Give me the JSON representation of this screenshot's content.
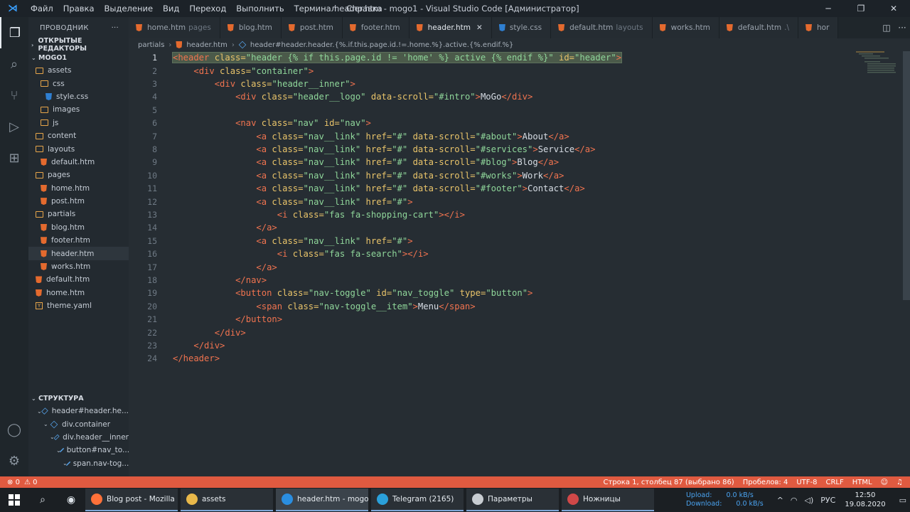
{
  "titlebar": {
    "menu": [
      "Файл",
      "Правка",
      "Выделение",
      "Вид",
      "Переход",
      "Выполнить",
      "Терминал",
      "Справка"
    ],
    "title": "header.htm - mogo1 - Visual Studio Code [Администратор]"
  },
  "sidebar": {
    "header": "ПРОВОДНИК",
    "open_editors": "ОТКРЫТЫЕ РЕДАКТОРЫ",
    "project": "MOGO1",
    "tree": [
      {
        "label": "assets",
        "type": "folder",
        "depth": 0
      },
      {
        "label": "css",
        "type": "folder",
        "depth": 1
      },
      {
        "label": "style.css",
        "type": "css",
        "depth": 2
      },
      {
        "label": "images",
        "type": "folder",
        "depth": 1
      },
      {
        "label": "js",
        "type": "folder",
        "depth": 1
      },
      {
        "label": "content",
        "type": "folder",
        "depth": 0
      },
      {
        "label": "layouts",
        "type": "folder",
        "depth": 0
      },
      {
        "label": "default.htm",
        "type": "html",
        "depth": 1
      },
      {
        "label": "pages",
        "type": "folder",
        "depth": 0
      },
      {
        "label": "home.htm",
        "type": "html",
        "depth": 1
      },
      {
        "label": "post.htm",
        "type": "html",
        "depth": 1
      },
      {
        "label": "partials",
        "type": "folder",
        "depth": 0
      },
      {
        "label": "blog.htm",
        "type": "html",
        "depth": 1
      },
      {
        "label": "footer.htm",
        "type": "html",
        "depth": 1
      },
      {
        "label": "header.htm",
        "type": "html",
        "depth": 1,
        "selected": true
      },
      {
        "label": "works.htm",
        "type": "html",
        "depth": 1
      },
      {
        "label": "default.htm",
        "type": "html",
        "depth": 0
      },
      {
        "label": "home.htm",
        "type": "html",
        "depth": 0
      },
      {
        "label": "theme.yaml",
        "type": "yaml",
        "depth": 0
      }
    ],
    "outline_title": "СТРУКТУРА",
    "outline": [
      {
        "label": "header#header.he...",
        "depth": 0
      },
      {
        "label": "div.container",
        "depth": 1
      },
      {
        "label": "div.header__inner",
        "depth": 2
      },
      {
        "label": "button#nav_to...",
        "depth": 3
      },
      {
        "label": "span.nav-tog...",
        "depth": 4
      }
    ]
  },
  "tabs": [
    {
      "label": "home.htm",
      "hint": "pages"
    },
    {
      "label": "blog.htm",
      "hint": ""
    },
    {
      "label": "post.htm",
      "hint": ""
    },
    {
      "label": "footer.htm",
      "hint": ""
    },
    {
      "label": "header.htm",
      "hint": "",
      "active": true
    },
    {
      "label": "style.css",
      "hint": "",
      "css": true
    },
    {
      "label": "default.htm",
      "hint": "layouts"
    },
    {
      "label": "works.htm",
      "hint": ""
    },
    {
      "label": "default.htm",
      "hint": ".\\"
    },
    {
      "label": "hor",
      "hint": ""
    }
  ],
  "breadcrumbs": [
    "partials",
    "header.htm",
    "header#header.header.{%.if.this.page.id.!=.home.%}.active.{%.endif.%}"
  ],
  "code": [
    [
      [
        "t",
        "<header"
      ],
      [
        "a",
        " class="
      ],
      [
        "s",
        "\"header {% if this.page.id != 'home' %} active {% endif %}\""
      ],
      [
        "a",
        " id="
      ],
      [
        "s",
        "\"header\""
      ],
      [
        "t",
        ">"
      ]
    ],
    [
      [
        "p",
        "    "
      ],
      [
        "t",
        "<div"
      ],
      [
        "a",
        " class="
      ],
      [
        "s",
        "\"container\""
      ],
      [
        "t",
        ">"
      ]
    ],
    [
      [
        "p",
        "        "
      ],
      [
        "t",
        "<div"
      ],
      [
        "a",
        " class="
      ],
      [
        "s",
        "\"header__inner\""
      ],
      [
        "t",
        ">"
      ]
    ],
    [
      [
        "p",
        "            "
      ],
      [
        "t",
        "<div"
      ],
      [
        "a",
        " class="
      ],
      [
        "s",
        "\"header__logo\""
      ],
      [
        "a",
        " data-scroll="
      ],
      [
        "s",
        "\"#intro\""
      ],
      [
        "t",
        ">"
      ],
      [
        "x",
        "MoGo"
      ],
      [
        "t",
        "</div>"
      ]
    ],
    [],
    [
      [
        "p",
        "            "
      ],
      [
        "t",
        "<nav"
      ],
      [
        "a",
        " class="
      ],
      [
        "s",
        "\"nav\""
      ],
      [
        "a",
        " id="
      ],
      [
        "s",
        "\"nav\""
      ],
      [
        "t",
        ">"
      ]
    ],
    [
      [
        "p",
        "                "
      ],
      [
        "t",
        "<a"
      ],
      [
        "a",
        " class="
      ],
      [
        "s",
        "\"nav__link\""
      ],
      [
        "a",
        " href="
      ],
      [
        "s",
        "\"#\""
      ],
      [
        "a",
        " data-scroll="
      ],
      [
        "s",
        "\"#about\""
      ],
      [
        "t",
        ">"
      ],
      [
        "x",
        "About"
      ],
      [
        "t",
        "</a>"
      ]
    ],
    [
      [
        "p",
        "                "
      ],
      [
        "t",
        "<a"
      ],
      [
        "a",
        " class="
      ],
      [
        "s",
        "\"nav__link\""
      ],
      [
        "a",
        " href="
      ],
      [
        "s",
        "\"#\""
      ],
      [
        "a",
        " data-scroll="
      ],
      [
        "s",
        "\"#services\""
      ],
      [
        "t",
        ">"
      ],
      [
        "x",
        "Service"
      ],
      [
        "t",
        "</a>"
      ]
    ],
    [
      [
        "p",
        "                "
      ],
      [
        "t",
        "<a"
      ],
      [
        "a",
        " class="
      ],
      [
        "s",
        "\"nav__link\""
      ],
      [
        "a",
        " href="
      ],
      [
        "s",
        "\"#\""
      ],
      [
        "a",
        " data-scroll="
      ],
      [
        "s",
        "\"#blog\""
      ],
      [
        "t",
        ">"
      ],
      [
        "x",
        "Blog"
      ],
      [
        "t",
        "</a>"
      ]
    ],
    [
      [
        "p",
        "                "
      ],
      [
        "t",
        "<a"
      ],
      [
        "a",
        " class="
      ],
      [
        "s",
        "\"nav__link\""
      ],
      [
        "a",
        " href="
      ],
      [
        "s",
        "\"#\""
      ],
      [
        "a",
        " data-scroll="
      ],
      [
        "s",
        "\"#works\""
      ],
      [
        "t",
        ">"
      ],
      [
        "x",
        "Work"
      ],
      [
        "t",
        "</a>"
      ]
    ],
    [
      [
        "p",
        "                "
      ],
      [
        "t",
        "<a"
      ],
      [
        "a",
        " class="
      ],
      [
        "s",
        "\"nav__link\""
      ],
      [
        "a",
        " href="
      ],
      [
        "s",
        "\"#\""
      ],
      [
        "a",
        " data-scroll="
      ],
      [
        "s",
        "\"#footer\""
      ],
      [
        "t",
        ">"
      ],
      [
        "x",
        "Contact"
      ],
      [
        "t",
        "</a>"
      ]
    ],
    [
      [
        "p",
        "                "
      ],
      [
        "t",
        "<a"
      ],
      [
        "a",
        " class="
      ],
      [
        "s",
        "\"nav__link\""
      ],
      [
        "a",
        " href="
      ],
      [
        "s",
        "\"#\""
      ],
      [
        "t",
        ">"
      ]
    ],
    [
      [
        "p",
        "                    "
      ],
      [
        "t",
        "<i"
      ],
      [
        "a",
        " class="
      ],
      [
        "s",
        "\"fas fa-shopping-cart\""
      ],
      [
        "t",
        "></i>"
      ]
    ],
    [
      [
        "p",
        "                "
      ],
      [
        "t",
        "</a>"
      ]
    ],
    [
      [
        "p",
        "                "
      ],
      [
        "t",
        "<a"
      ],
      [
        "a",
        " class="
      ],
      [
        "s",
        "\"nav__link\""
      ],
      [
        "a",
        " href="
      ],
      [
        "s",
        "\"#\""
      ],
      [
        "t",
        ">"
      ]
    ],
    [
      [
        "p",
        "                    "
      ],
      [
        "t",
        "<i"
      ],
      [
        "a",
        " class="
      ],
      [
        "s",
        "\"fas fa-search\""
      ],
      [
        "t",
        "></i>"
      ]
    ],
    [
      [
        "p",
        "                "
      ],
      [
        "t",
        "</a>"
      ]
    ],
    [
      [
        "p",
        "            "
      ],
      [
        "t",
        "</nav>"
      ]
    ],
    [
      [
        "p",
        "            "
      ],
      [
        "t",
        "<button"
      ],
      [
        "a",
        " class="
      ],
      [
        "s",
        "\"nav-toggle\""
      ],
      [
        "a",
        " id="
      ],
      [
        "s",
        "\"nav_toggle\""
      ],
      [
        "a",
        " type="
      ],
      [
        "s",
        "\"button\""
      ],
      [
        "t",
        ">"
      ]
    ],
    [
      [
        "p",
        "                "
      ],
      [
        "t",
        "<span"
      ],
      [
        "a",
        " class="
      ],
      [
        "s",
        "\"nav-toggle__item\""
      ],
      [
        "t",
        ">"
      ],
      [
        "x",
        "Menu"
      ],
      [
        "t",
        "</span>"
      ]
    ],
    [
      [
        "p",
        "            "
      ],
      [
        "t",
        "</button>"
      ]
    ],
    [
      [
        "p",
        "        "
      ],
      [
        "t",
        "</div>"
      ]
    ],
    [
      [
        "p",
        "    "
      ],
      [
        "t",
        "</div>"
      ]
    ],
    [
      [
        "t",
        "</header>"
      ]
    ]
  ],
  "status": {
    "errors": "0",
    "warnings": "0",
    "position": "Строка 1, столбец 87 (выбрано 86)",
    "spaces": "Пробелов: 4",
    "encoding": "UTF-8",
    "eol": "CRLF",
    "language": "HTML"
  },
  "taskbar": {
    "apps": [
      {
        "label": "Blog post - Mozilla ...",
        "color": "#ff7139"
      },
      {
        "label": "assets",
        "color": "#e8b84a"
      },
      {
        "label": "header.htm - mogo1...",
        "color": "#2a8ee0",
        "active": true
      },
      {
        "label": "Telegram (2165)",
        "color": "#2aa0da"
      },
      {
        "label": "Параметры",
        "color": "#c8cdd2"
      },
      {
        "label": "Ножницы",
        "color": "#d04848"
      }
    ],
    "upload_label": "Upload:",
    "upload_value": "0.0 kB/s",
    "download_label": "Download:",
    "download_value": "0.0 kB/s",
    "lang": "РУС",
    "time": "12:50",
    "date": "19.08.2020"
  }
}
